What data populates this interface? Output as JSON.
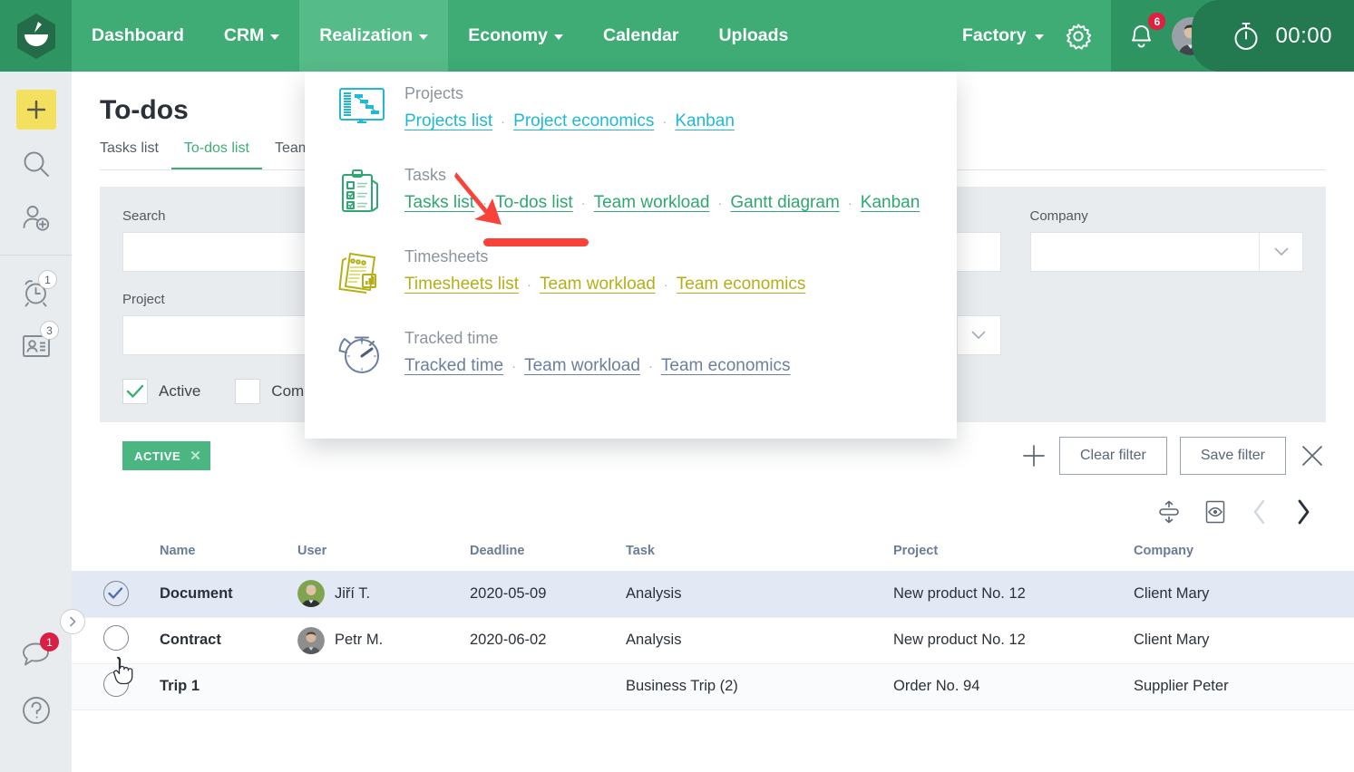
{
  "topnav": {
    "logo_name": "bowl-logo",
    "items": [
      {
        "label": "Dashboard",
        "has_caret": false,
        "active": false
      },
      {
        "label": "CRM",
        "has_caret": true,
        "active": false
      },
      {
        "label": "Realization",
        "has_caret": true,
        "active": true
      },
      {
        "label": "Economy",
        "has_caret": true,
        "active": false
      },
      {
        "label": "Calendar",
        "has_caret": false,
        "active": false
      },
      {
        "label": "Uploads",
        "has_caret": false,
        "active": false
      }
    ],
    "factory_label": "Factory",
    "gear_icon": "gear-icon",
    "bell_icon": "bell-icon",
    "bell_badge": "6",
    "avatar": "user-avatar",
    "timer_icon": "stopwatch-icon",
    "timer_value": "00:00"
  },
  "rail": {
    "items": [
      {
        "name": "add-icon",
        "badge": null
      },
      {
        "name": "search-icon",
        "badge": null
      },
      {
        "name": "add-user-icon",
        "badge": null
      },
      {
        "name": "alarm-clock-icon",
        "badge": "1"
      },
      {
        "name": "contact-card-icon",
        "badge": "3"
      }
    ],
    "bottom_items": [
      {
        "name": "chat-bubble-icon",
        "badge": "1"
      },
      {
        "name": "help-icon",
        "badge": null
      }
    ],
    "expand_icon": "chevron-right-icon"
  },
  "page": {
    "title": "To-dos",
    "tabs": [
      {
        "label": "Tasks list",
        "active": false
      },
      {
        "label": "To-dos list",
        "active": true
      },
      {
        "label": "Team",
        "active": false
      }
    ]
  },
  "filters": {
    "fields": [
      {
        "label": "Search",
        "type": "text",
        "value": "",
        "placeholder": ""
      },
      {
        "label": "Project",
        "type": "text",
        "value": "",
        "placeholder": ""
      },
      {
        "label": "Company",
        "type": "select",
        "value": "",
        "placeholder": ""
      }
    ],
    "checkboxes": [
      {
        "label": "Active",
        "checked": true
      },
      {
        "label": "Completed",
        "checked": false
      }
    ],
    "chip": {
      "label": "ACTIVE",
      "close_icon": "close-icon"
    },
    "add_icon": "plus-icon",
    "clear_label": "Clear filter",
    "save_label": "Save filter",
    "close_icon": "close-icon"
  },
  "table_toolbar": {
    "row_height_icon": "row-height-icon",
    "preview_icon": "preview-eye-icon",
    "prev_icon": "chevron-left-icon",
    "next_icon": "chevron-right-icon"
  },
  "table": {
    "columns": [
      "",
      "Name",
      "User",
      "Deadline",
      "Task",
      "Project",
      "Company"
    ],
    "rows": [
      {
        "selected": true,
        "checkbox": "checked",
        "name": "Document",
        "user": "Jiří T.",
        "user_avatar": "avatar-jiri",
        "deadline": "2020-05-09",
        "task": "Analysis",
        "project": "New product No. 12",
        "company": "Client Mary"
      },
      {
        "selected": false,
        "checkbox": "unchecked",
        "name": "Contract",
        "user": "Petr M.",
        "user_avatar": "avatar-petr",
        "deadline": "2020-06-02",
        "task": "Analysis",
        "project": "New product No. 12",
        "company": "Client Mary"
      },
      {
        "selected": false,
        "checkbox": "unchecked",
        "name": "Trip 1",
        "user": "",
        "user_avatar": "",
        "deadline": "",
        "task": "Business Trip (2)",
        "project": "Order No. 94",
        "company": "Supplier Peter"
      }
    ]
  },
  "mega_menu": {
    "groups": [
      {
        "icon": "monitor-gantt-icon",
        "title": "Projects",
        "color_class": "lnk-projects",
        "links": [
          "Projects list",
          "Project economics",
          "Kanban"
        ]
      },
      {
        "icon": "clipboard-checklist-icon",
        "title": "Tasks",
        "color_class": "lnk-tasks",
        "links": [
          "Tasks list",
          "To-dos list",
          "Team workload",
          "Gantt diagram",
          "Kanban"
        ]
      },
      {
        "icon": "timesheet-papers-icon",
        "title": "Timesheets",
        "color_class": "lnk-timesheets",
        "links": [
          "Timesheets list",
          "Team workload",
          "Team economics"
        ]
      },
      {
        "icon": "stopwatch-tracked-icon",
        "title": "Tracked time",
        "color_class": "lnk-tracked",
        "links": [
          "Tracked time",
          "Team workload",
          "Team economics"
        ]
      }
    ],
    "separator": "·"
  },
  "annotation": {
    "arrow_icon": "red-arrow-icon",
    "highlight_target": "To-dos list",
    "color": "#f9423a"
  },
  "colors": {
    "brand_green": "#3eac74",
    "brand_green_dark": "#2e9461",
    "accent_yellow": "#f2e05e",
    "badge_red": "#e02040",
    "panel_gray": "#e9ecee",
    "row_selected": "#e3e8f5"
  }
}
